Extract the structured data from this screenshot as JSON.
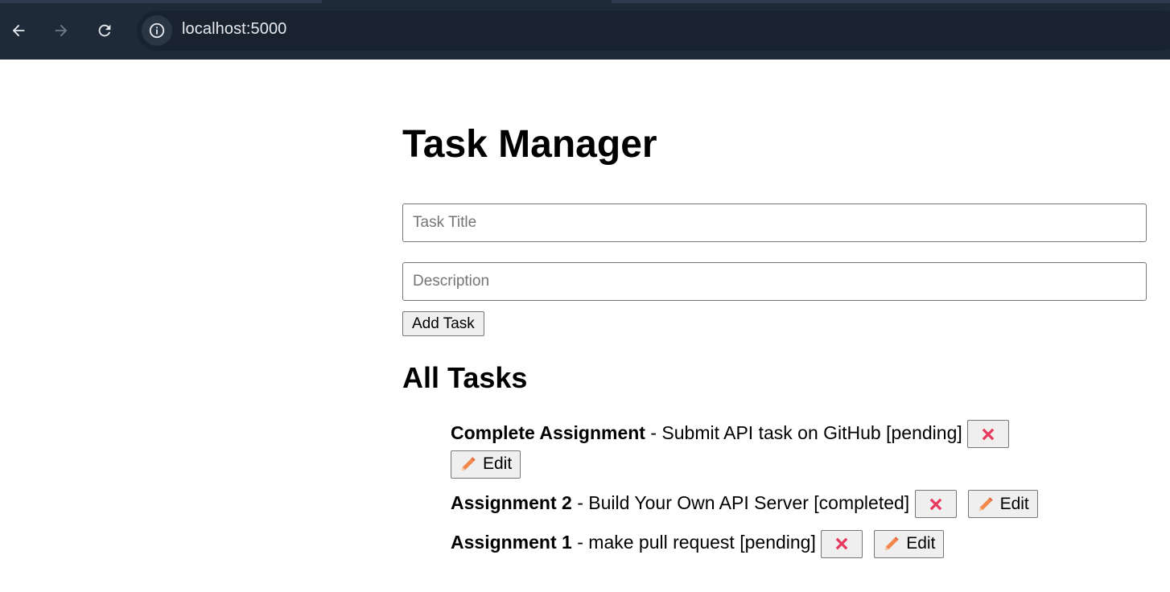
{
  "browser": {
    "url": "localhost:5000"
  },
  "page": {
    "title": "Task Manager",
    "form": {
      "title_placeholder": "Task Title",
      "title_value": "",
      "description_placeholder": "Description",
      "description_value": "",
      "add_button_label": "Add Task"
    },
    "list_heading": "All Tasks",
    "tasks": [
      {
        "title": "Complete Assignment",
        "separator": " - ",
        "description": "Submit API task on GitHub",
        "status": "[pending]",
        "delete_icon": "cross-mark-icon",
        "edit_icon": "pencil-icon",
        "edit_label": "Edit"
      },
      {
        "title": "Assignment 2",
        "separator": " - ",
        "description": "Build Your Own API Server",
        "status": "[completed]",
        "delete_icon": "cross-mark-icon",
        "edit_icon": "pencil-icon",
        "edit_label": "Edit"
      },
      {
        "title": "Assignment 1",
        "separator": " - ",
        "description": "make pull request",
        "status": "[pending]",
        "delete_icon": "cross-mark-icon",
        "edit_icon": "pencil-icon",
        "edit_label": "Edit"
      }
    ]
  },
  "colors": {
    "chrome_bg": "#1f2a38",
    "delete_icon": "#e8395f",
    "edit_icon": "#f2884b"
  }
}
